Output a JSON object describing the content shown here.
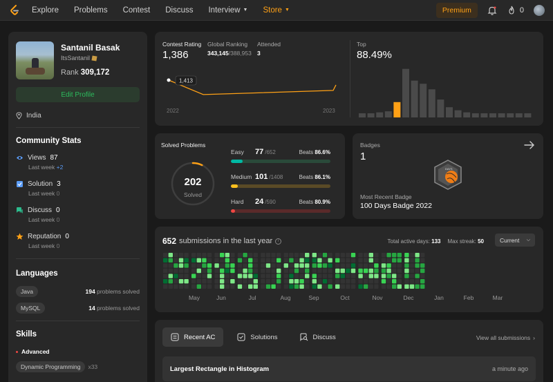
{
  "nav": {
    "items": [
      {
        "label": "Explore",
        "caret": false,
        "store": false
      },
      {
        "label": "Problems",
        "caret": false,
        "store": false
      },
      {
        "label": "Contest",
        "caret": false,
        "store": false
      },
      {
        "label": "Discuss",
        "caret": false,
        "store": false
      },
      {
        "label": "Interview",
        "caret": true,
        "store": false
      },
      {
        "label": "Store",
        "caret": true,
        "store": true
      }
    ],
    "premium_label": "Premium",
    "streak_count": "0"
  },
  "profile": {
    "name": "Santanil Basak",
    "handle": "ItsSantanil",
    "rank_label": "Rank",
    "rank_value": "309,172",
    "edit_label": "Edit Profile",
    "location": "India"
  },
  "community": {
    "title": "Community Stats",
    "last_week_label": "Last week",
    "items": [
      {
        "label": "Views",
        "value": "87",
        "delta": "+2",
        "icon": "eye-icon",
        "color": "#5a9cf7"
      },
      {
        "label": "Solution",
        "value": "3",
        "delta": "0",
        "icon": "solution-icon",
        "color": "#5a9cf7"
      },
      {
        "label": "Discuss",
        "value": "0",
        "delta": "0",
        "icon": "discuss-icon",
        "color": "#2cbb8d"
      },
      {
        "label": "Reputation",
        "value": "0",
        "delta": "0",
        "icon": "star-icon",
        "color": "#ffa116"
      }
    ]
  },
  "languages": {
    "title": "Languages",
    "suffix": "problems solved",
    "items": [
      {
        "name": "Java",
        "count": "194"
      },
      {
        "name": "MySQL",
        "count": "14"
      }
    ]
  },
  "skills": {
    "title": "Skills",
    "level": "Advanced",
    "items": [
      {
        "name": "Dynamic Programming",
        "count": "x33"
      }
    ]
  },
  "contest": {
    "rating_label": "Contest Rating",
    "rating": "1,386",
    "global_label": "Global Ranking",
    "global_rank": "343,145",
    "global_total": "/388,953",
    "attended_label": "Attended",
    "attended": "3",
    "tooltip": "1,413",
    "year_start": "2022",
    "year_end": "2023",
    "top_label": "Top",
    "top_value": "88.49%",
    "rating_series": [
      1413,
      1375,
      1386
    ],
    "histogram": [
      0.08,
      0.08,
      0.1,
      0.12,
      0.3,
      0.95,
      0.72,
      0.66,
      0.55,
      0.35,
      0.2,
      0.14,
      0.1,
      0.08,
      0.08,
      0.08,
      0.08,
      0.08,
      0.08,
      0.08
    ],
    "histogram_highlight": 4
  },
  "solved": {
    "title": "Solved Problems",
    "total": "202",
    "total_label": "Solved",
    "beats_label": "Beats",
    "difficulties": [
      {
        "name": "Easy",
        "solved": "77",
        "total": "/652",
        "beats": "86.6%",
        "fraction": 0.118,
        "color": "#00b8a3",
        "track": "#2a4a3a"
      },
      {
        "name": "Medium",
        "solved": "101",
        "total": "/1408",
        "beats": "86.1%",
        "fraction": 0.072,
        "color": "#ffc01e",
        "track": "#5a4a26"
      },
      {
        "name": "Hard",
        "solved": "24",
        "total": "/590",
        "beats": "80.9%",
        "fraction": 0.041,
        "color": "#ef4743",
        "track": "#5a2a2a"
      }
    ],
    "ring_fraction": 0.073
  },
  "badges": {
    "label": "Badges",
    "count": "1",
    "recent_label": "Most Recent Badge",
    "recent_name": "100 Days Badge 2022",
    "hex_text": "DAYS"
  },
  "submissions": {
    "count": "652",
    "label": "submissions in the last year",
    "active_label": "Total active days:",
    "active_value": "133",
    "streak_label": "Max streak:",
    "streak_value": "50",
    "dropdown": "Current",
    "months": [
      "May",
      "Jun",
      "Jul",
      "Aug",
      "Sep",
      "Oct",
      "Nov",
      "Dec",
      "Jan",
      "Feb",
      "Mar"
    ]
  },
  "recent": {
    "tabs": [
      {
        "label": "Recent AC",
        "active": true,
        "icon": "list-icon"
      },
      {
        "label": "Solutions",
        "active": false,
        "icon": "check-square-icon"
      },
      {
        "label": "Discuss",
        "active": false,
        "icon": "discuss-search-icon"
      }
    ],
    "view_all": "View all submissions",
    "items": [
      {
        "title": "Largest Rectangle in Histogram",
        "time": "a minute ago"
      }
    ]
  }
}
